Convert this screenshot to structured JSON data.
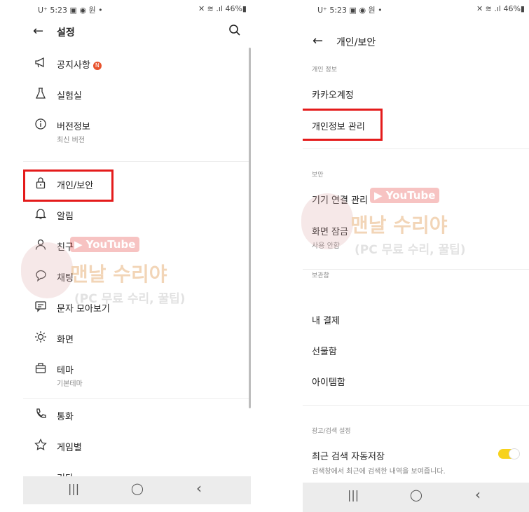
{
  "left": {
    "status": {
      "left": "U⁺ 5:23 ▣ ◉ 원 •",
      "right": "✕ ≋ .ıl 46%▮"
    },
    "header": {
      "back": "←",
      "title": "설정"
    },
    "items": [
      {
        "label": "공지사항",
        "badge": "N",
        "icon": "megaphone-icon"
      },
      {
        "label": "실험실",
        "icon": "flask-icon"
      },
      {
        "label": "버전정보",
        "sub": "최신 버전",
        "icon": "info-icon"
      },
      {
        "label": "개인/보안",
        "icon": "lock-icon"
      },
      {
        "label": "알림",
        "icon": "bell-icon"
      },
      {
        "label": "친구",
        "icon": "person-icon"
      },
      {
        "label": "채팅",
        "icon": "chat-icon"
      },
      {
        "label": "문자 모아보기",
        "icon": "message-icon"
      },
      {
        "label": "화면",
        "icon": "sun-icon"
      },
      {
        "label": "테마",
        "sub": "기본테마",
        "icon": "theme-icon"
      },
      {
        "label": "통화",
        "icon": "phone-icon"
      },
      {
        "label": "게임별",
        "icon": "star-icon"
      },
      {
        "label": "기타",
        "icon": "etc-icon"
      }
    ]
  },
  "right": {
    "status": {
      "left": "U⁺ 5:23 ▣ ◉ 원 •",
      "right": "✕ ≋ .ıl 46%▮"
    },
    "header": {
      "back": "←",
      "title": "개인/보안"
    },
    "sections": {
      "personal": "개인 정보",
      "security": "보안",
      "storage": "보관함",
      "ads": "광고/검색 설정"
    },
    "items": {
      "kakao_account": "카카오계정",
      "privacy_manage": "개인정보 관리",
      "device_manage": "기기 연결 관리",
      "screen_lock": "화면 잠금",
      "screen_lock_sub": "사용 안함",
      "my_payment": "내 결제",
      "gift_box": "선물함",
      "item_box": "아이템함",
      "auto_save": "최근 검색 자동저장",
      "auto_save_sub": "검색창에서 최근에 검색한 내역을 보여줍니다."
    },
    "auto_save_on": true
  },
  "navbar": {
    "recent": "|||",
    "home": "◯",
    "back": "‹"
  },
  "watermark": {
    "youtube": "▶ YouTube",
    "title": "맨날 수리야",
    "subtitle": "(PC 무료 수리, 꿀팁)"
  },
  "colors": {
    "highlight": "#e41b1b",
    "toggle": "#f7d21c",
    "badge": "#e8532d"
  }
}
